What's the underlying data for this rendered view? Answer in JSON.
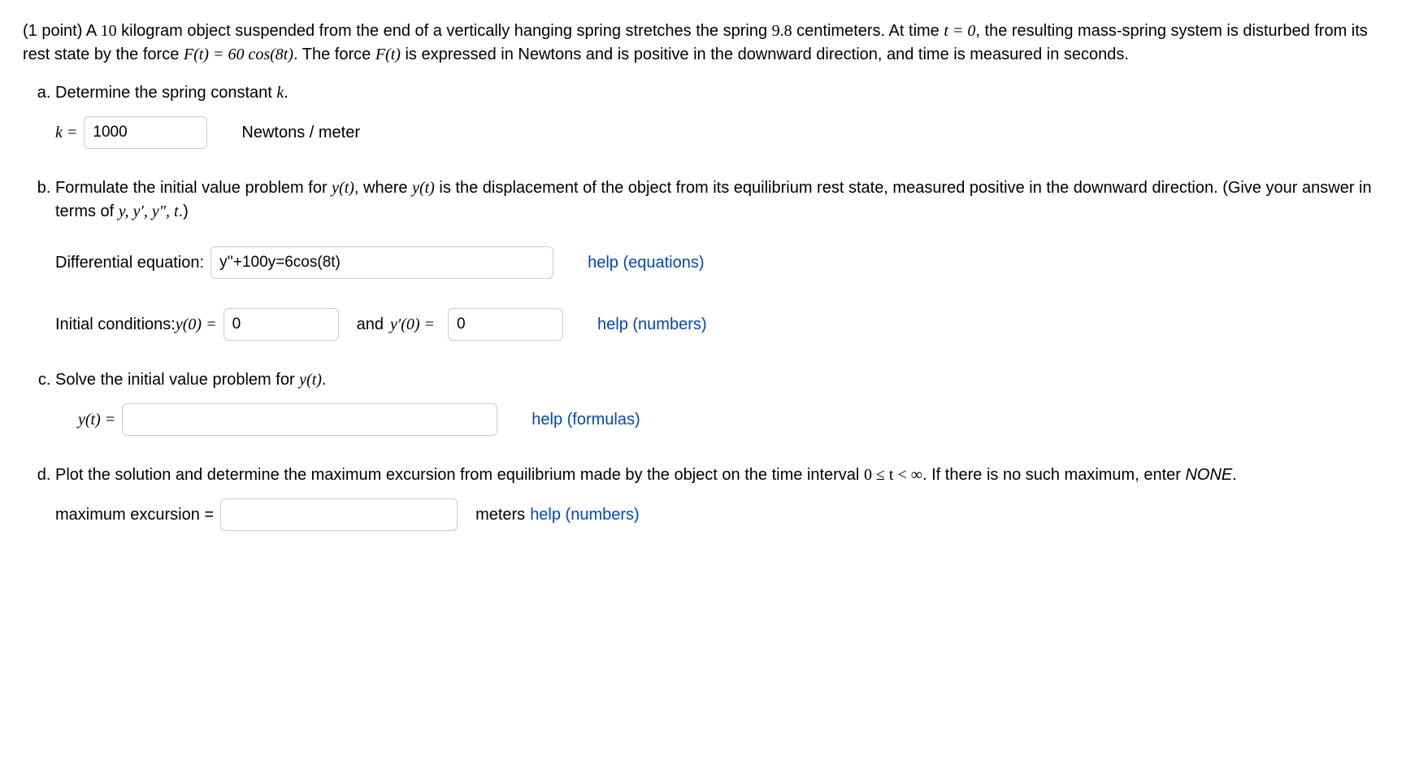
{
  "intro": {
    "points": "(1 point) ",
    "s1a": "A ",
    "mass": "10",
    "s1b": " kilogram object suspended from the end of a vertically hanging spring stretches the spring ",
    "stretch": "9.8",
    "s1c": " centimeters. At time ",
    "t0": "t = 0",
    "s1d": ", the resulting mass-spring system is disturbed from its rest state by the force ",
    "Ft": "F(t) = 60 cos(8t)",
    "s1e": ". The force ",
    "Ft2": "F(t)",
    "s1f": " is expressed in Newtons and is positive in the downward direction, and time is measured in seconds."
  },
  "a": {
    "prompt_prefix": "Determine the spring constant ",
    "prompt_k": "k",
    "prompt_suffix": ".",
    "k_label": "k = ",
    "k_value": "1000",
    "units": "Newtons / meter"
  },
  "b": {
    "p1": "Formulate the initial value problem for ",
    "yt": "y(t)",
    "p2": ", where ",
    "p3": " is the displacement of the object from its equilibrium rest state, measured positive in the downward direction. (Give your answer in terms of ",
    "vars": "y, y′, y″, t",
    "p4": ".)",
    "de_label": "Differential equation:",
    "de_value": "y''+100y=6cos(8t)",
    "help_eq": "help (equations)",
    "ic_label": "Initial conditions: ",
    "y0": "y(0) = ",
    "y0_value": "0",
    "and": " and ",
    "yp0": "y′(0) = ",
    "yp0_value": "0",
    "help_num": "help (numbers)"
  },
  "c": {
    "prompt_prefix": "Solve the initial value problem for ",
    "yt": "y(t)",
    "prompt_suffix": ".",
    "label": "y(t) = ",
    "value": "",
    "help": "help (formulas)"
  },
  "d": {
    "p1": "Plot the solution and determine the maximum excursion from equilibrium made by the object on the time interval ",
    "interval": "0 ≤ t < ∞",
    "p2": ". If there is no such maximum, enter ",
    "none": "NONE",
    "p3": ".",
    "label": "maximum excursion =",
    "value": "",
    "units": "meters",
    "help": "help (numbers)"
  }
}
